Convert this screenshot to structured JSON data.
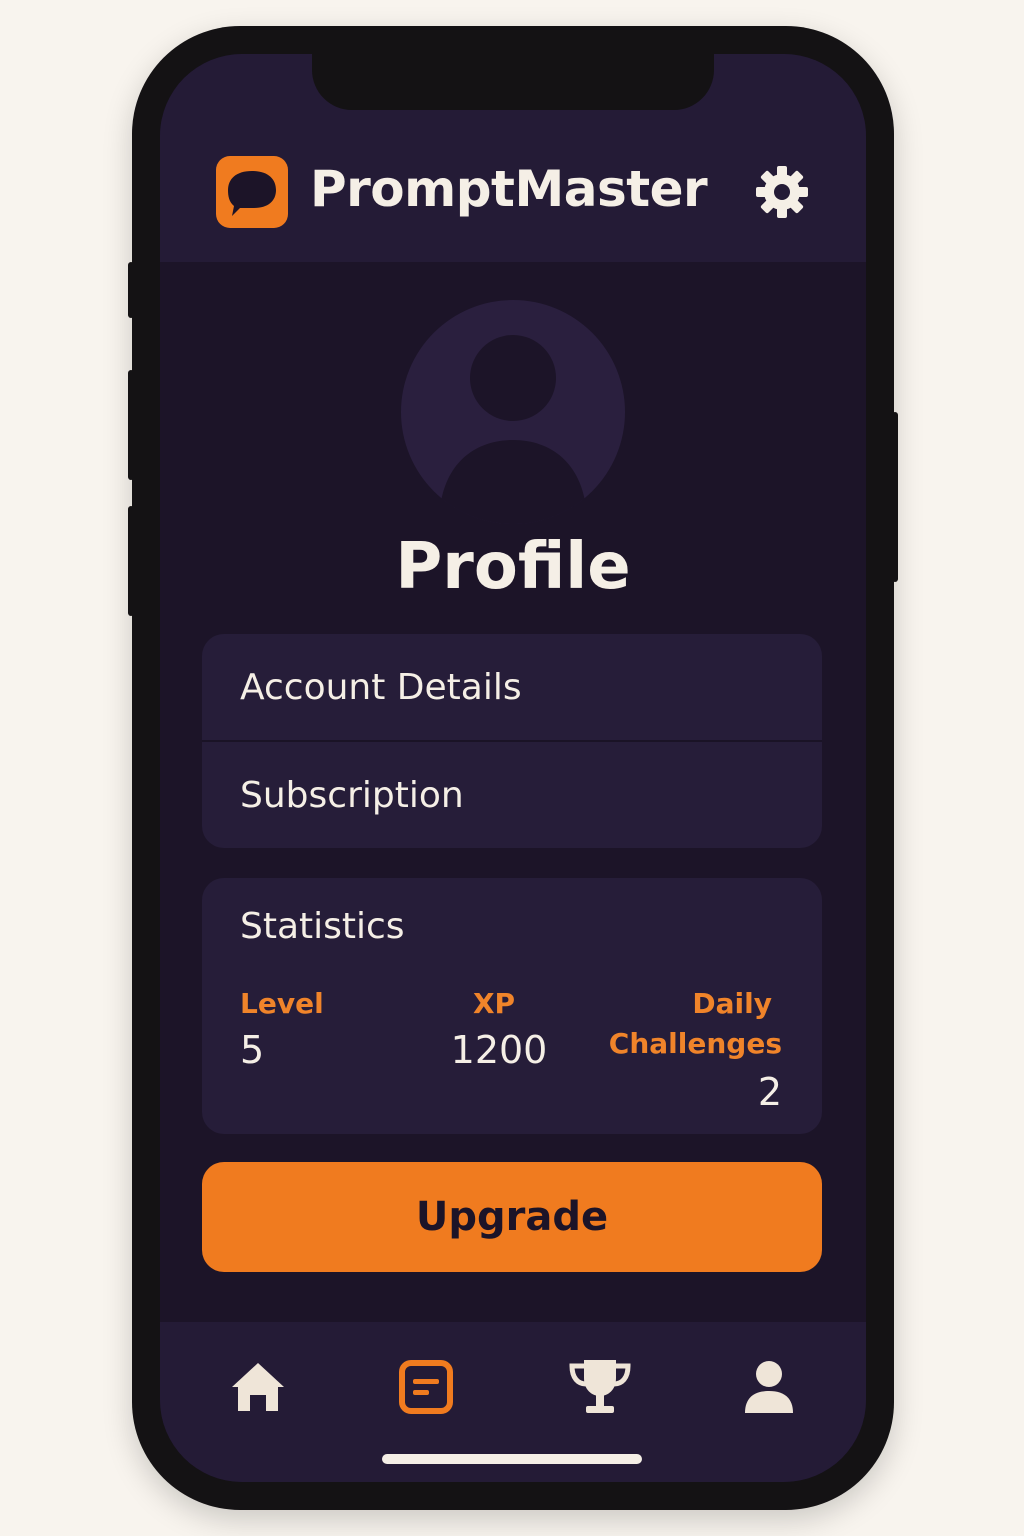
{
  "app": {
    "name": "PromptMaster",
    "logo_icon": "chat-bubble-icon",
    "settings_icon": "gear-icon"
  },
  "page": {
    "title": "Profile",
    "avatar_icon": "user-silhouette-icon"
  },
  "menu": {
    "items": [
      {
        "label": "Account Details"
      },
      {
        "label": "Subscription"
      }
    ]
  },
  "statistics": {
    "title": "Statistics",
    "level": {
      "label": "Level",
      "value": "5"
    },
    "xp": {
      "label": "XP",
      "value": "1200"
    },
    "daily": {
      "label_line1": "Daily",
      "label_line2": "Challenges",
      "value": "2"
    }
  },
  "actions": {
    "upgrade_label": "Upgrade"
  },
  "nav": {
    "items": [
      {
        "icon": "home-icon",
        "active": false
      },
      {
        "icon": "prompts-icon",
        "active": true
      },
      {
        "icon": "trophy-icon",
        "active": false
      },
      {
        "icon": "profile-icon",
        "active": false
      }
    ]
  },
  "colors": {
    "accent": "#f07b1f",
    "background": "#1c1428",
    "card": "#261d39",
    "text": "#f5efe6"
  }
}
